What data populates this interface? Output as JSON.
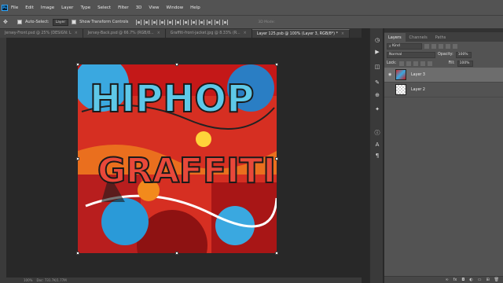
{
  "menu": {
    "logo": "Ps",
    "items": [
      "File",
      "Edit",
      "Image",
      "Layer",
      "Type",
      "Select",
      "Filter",
      "3D",
      "View",
      "Window",
      "Help"
    ]
  },
  "options": {
    "auto_select_label": "Auto-Select:",
    "auto_select_target": "Layer",
    "transform_controls_label": "Show Transform Controls",
    "mode_3d_label": "3D Mode:"
  },
  "tabs": [
    {
      "label": "Jersey-Front.psd @ 25% (DESIGN: L",
      "active": false
    },
    {
      "label": "Jersey-Back.psd @ 66.7% (RGB/8...",
      "active": false
    },
    {
      "label": "Graffiti-front-jacket.jpg @ 8.33% (R...",
      "active": false
    },
    {
      "label": "Layer 125.psb @ 100% (Layer 3, RGB/8*) *",
      "active": true
    }
  ],
  "status": {
    "zoom": "100%",
    "doc": "Doc: 731.7K/1.77M"
  },
  "panel": {
    "tabs": [
      "Layers",
      "Channels",
      "Paths"
    ],
    "filter_kind": "Kind",
    "blend_mode": "Normal",
    "opacity_label": "Opacity:",
    "opacity_value": "100%",
    "lock_label": "Lock:",
    "fill_label": "Fill:",
    "fill_value": "100%",
    "layers": [
      {
        "name": "Layer 3",
        "visible": true,
        "selected": true,
        "thumb": "artwork"
      },
      {
        "name": "Layer 2",
        "visible": false,
        "selected": false,
        "thumb": "transparent"
      }
    ],
    "footer_icons": [
      "link-icon",
      "fx-icon",
      "mask-icon",
      "adjustment-icon",
      "folder-icon",
      "new-layer-icon",
      "trash-icon"
    ]
  },
  "side_icons": [
    "history-icon",
    "play-icon",
    "layer-comps-icon",
    "brush-icon",
    "clone-source-icon",
    "tool-presets-icon",
    "info-icon",
    "character-icon",
    "paragraph-icon"
  ],
  "artwork": {
    "text_top": "HIPHOP",
    "text_bottom": "GRAFFITI",
    "colors": {
      "background": "#e63a2a",
      "blue": "#3aa8e0",
      "red": "#c41818",
      "orange": "#f28a1c"
    }
  }
}
